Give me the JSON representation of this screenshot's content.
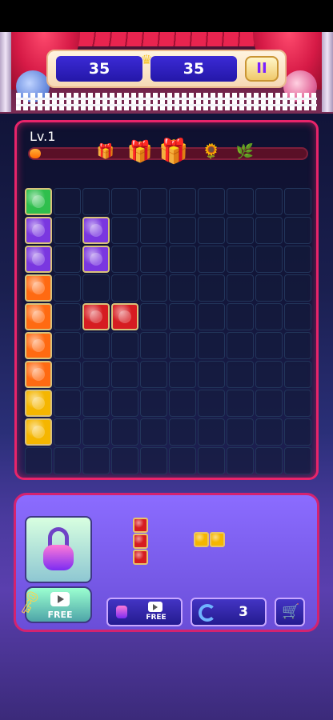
{
  "header": {
    "best_score": "35",
    "current_score": "35",
    "pause_label": "II",
    "crown_icon": "crown-icon"
  },
  "level": {
    "label": "Lv.1",
    "progress": 0.02,
    "rewards": [
      "small-gift-icon",
      "gift-box-icon",
      "big-gift-icon",
      "sunflower-icon",
      "plant-icon"
    ]
  },
  "colors": {
    "green": "#2fbf4d",
    "purple": "#7a37e0",
    "orange": "#ff6a12",
    "red": "#d61c21",
    "yellow": "#f5b600",
    "board_border": "#e8246a"
  },
  "board": {
    "rows": 10,
    "cols": 10,
    "gems": [
      {
        "r": 0,
        "c": 0,
        "color": "green"
      },
      {
        "r": 1,
        "c": 0,
        "color": "purple"
      },
      {
        "r": 1,
        "c": 2,
        "color": "purple"
      },
      {
        "r": 2,
        "c": 0,
        "color": "purple"
      },
      {
        "r": 2,
        "c": 2,
        "color": "purple"
      },
      {
        "r": 3,
        "c": 0,
        "color": "orange"
      },
      {
        "r": 4,
        "c": 0,
        "color": "orange"
      },
      {
        "r": 4,
        "c": 2,
        "color": "red"
      },
      {
        "r": 4,
        "c": 3,
        "color": "red"
      },
      {
        "r": 5,
        "c": 0,
        "color": "orange"
      },
      {
        "r": 6,
        "c": 0,
        "color": "orange"
      },
      {
        "r": 7,
        "c": 0,
        "color": "yellow"
      },
      {
        "r": 8,
        "c": 0,
        "color": "yellow"
      }
    ]
  },
  "pieces": [
    {
      "name": "vertical-red-3",
      "color": "red",
      "cells": [
        [
          0,
          0
        ],
        [
          1,
          0
        ],
        [
          2,
          0
        ]
      ]
    },
    {
      "name": "horizontal-yellow-2",
      "color": "yellow",
      "cells": [
        [
          0,
          0
        ],
        [
          0,
          1
        ]
      ]
    }
  ],
  "bottom": {
    "free_label": "FREE",
    "unlock_free_label": "FREE",
    "refresh_count": "3"
  }
}
